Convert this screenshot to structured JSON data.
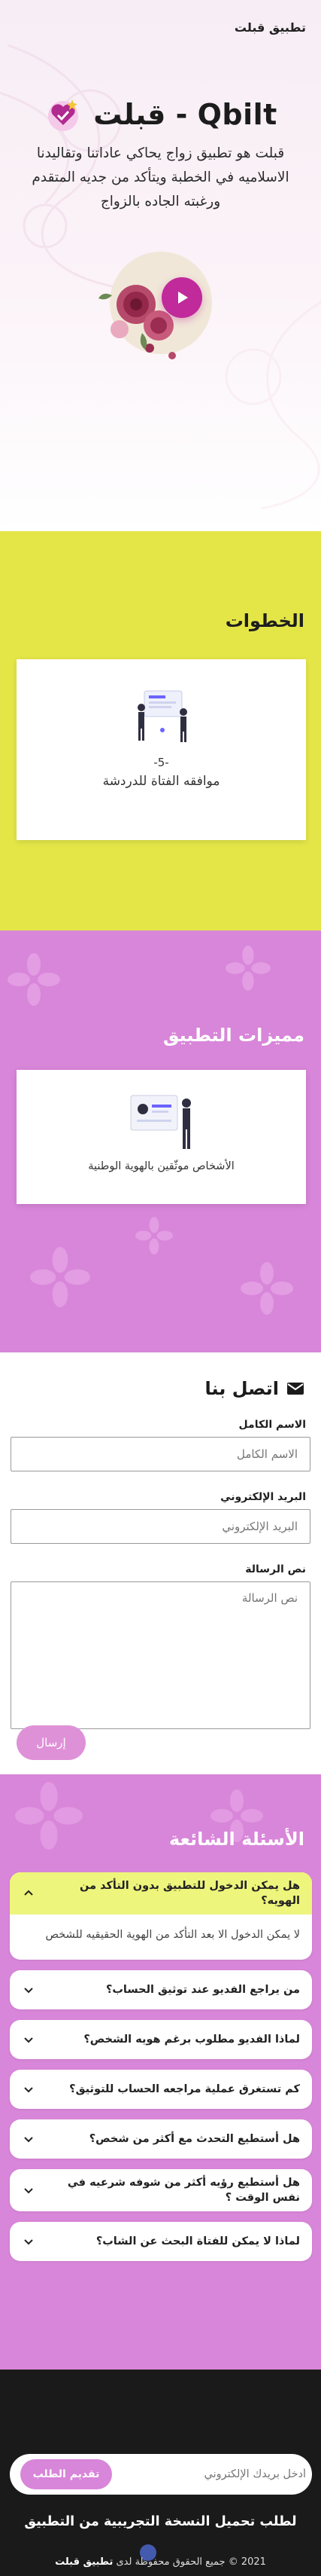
{
  "header": {
    "brand": "تطبيق قبلت"
  },
  "hero": {
    "title": "قبلت - Qbilt",
    "description": "قبلت هو تطبيق زواج يحاكي عاداتنا وتقاليدنا الاسلاميه في الخطبة ويتأكد من جديه المتقدم ورغبته الجاده بالزواج"
  },
  "steps": {
    "title": "الخطوات",
    "items": [
      {
        "number": "-5-",
        "caption": "موافقه الفتاة للدردشة"
      }
    ]
  },
  "features": {
    "title": "مميزات التطبيق",
    "items": [
      {
        "caption": "الأشخاص موثّقين بالهوية الوطنية"
      }
    ]
  },
  "contact": {
    "title": "اتصل بنا",
    "name_label": "الاسم الكامل",
    "name_placeholder": "الاسم الكامل",
    "email_label": "البريد الإلكتروني",
    "email_placeholder": "البريد الإلكتروني",
    "message_label": "نص الرسالة",
    "message_placeholder": "نص الرسالة",
    "send_label": "إرسال"
  },
  "faq": {
    "title": "الأسئلة الشائعة",
    "items": [
      {
        "q": "هل يمكن الدخول للتطبيق بدون التأكد من الهويه؟",
        "a": "لا يمكن الدخول الا بعد التأكد من الهوية الحقيقيه للشخص",
        "open": true
      },
      {
        "q": "من يراجع الفديو عند توثيق الحساب؟",
        "open": false
      },
      {
        "q": "لماذا الفديو مطلوب برغم هويه الشخص؟",
        "open": false
      },
      {
        "q": "كم تستغرق عملية مراجعه الحساب للتوثيق؟",
        "open": false
      },
      {
        "q": "هل أستطيع التحدث مع أكثر من شخص؟",
        "open": false
      },
      {
        "q": "هل أستطيع رؤيه أكثر من شوفه شرعيه في نفس الوقت ؟",
        "open": false
      },
      {
        "q": "لماذا لا يمكن للفتاة البحث عن الشاب؟",
        "open": false
      }
    ]
  },
  "footer": {
    "email_placeholder": "أدخل بريدك الإلكتروني",
    "submit_label": "تقديم الطلب",
    "cta": "لطلب تحميل النسخة التجريبية من التطبيق",
    "copyright_prefix": "2021 © جميع الحقوق محفوظة لدى",
    "copyright_brand": "تطبيق قبلت"
  },
  "colors": {
    "steps_bg": "#e4e648",
    "pink_bg": "#d886d9",
    "accent": "#c02a9a",
    "faq_open": "#eef57c",
    "footer_bg": "#1a1a1a"
  },
  "icons": [
    "heart-logo-icon",
    "play-icon",
    "envelope-icon",
    "chevron-down-icon",
    "chevron-up-icon"
  ]
}
